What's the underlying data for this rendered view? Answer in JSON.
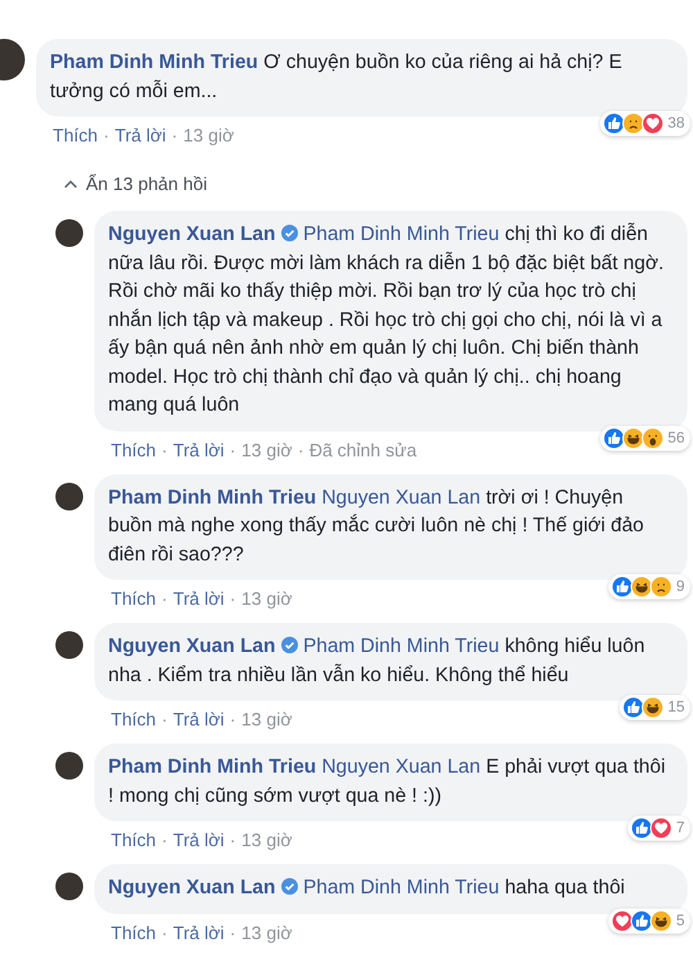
{
  "separator": "·",
  "comment": {
    "author": "Pham Dinh Minh Trieu",
    "text": "Ơ chuyện buồn ko của riêng ai hả chị? E tưởng có mỗi em...",
    "actions": [
      "Thích",
      "Trả lời",
      "13 giờ"
    ],
    "reactions": [
      {
        "kind": "like"
      },
      {
        "kind": "sad"
      },
      {
        "kind": "love"
      }
    ],
    "count": "38"
  },
  "toggle": {
    "label": "Ẩn 13 phản hồi",
    "expanded": true
  },
  "replies": [
    {
      "author": "Nguyen Xuan Lan",
      "verified": true,
      "mention": "Pham Dinh Minh Trieu",
      "text": "chị thì ko đi diễn nữa lâu rồi. Được mời làm khách ra diễn 1 bộ đặc biệt bất ngờ. Rồi chờ mãi ko thấy thiệp mời. Rồi bạn trơ lý của học trò chị nhắn lịch tập và makeup . Rồi học trò chị gọi cho chị, nói là vì a ấy bận quá nên ảnh nhờ em quản lý chị luôn. Chị biến thành model. Học trò chị thành chỉ đạo và quản lý chị.. chị hoang mang quá luôn",
      "actions": [
        "Thích",
        "Trả lời",
        "13 giờ",
        "Đã chỉnh sửa"
      ],
      "reactions": [
        {
          "kind": "like"
        },
        {
          "kind": "haha"
        },
        {
          "kind": "wow"
        }
      ],
      "count": "56"
    },
    {
      "author": "Pham Dinh Minh Trieu",
      "verified": false,
      "mention": "Nguyen Xuan Lan",
      "text": "trời ơi ! Chuyện buồn mà nghe xong thấy mắc cười luôn nè chị ! Thế giới đảo điên rồi sao???",
      "actions": [
        "Thích",
        "Trả lời",
        "13 giờ"
      ],
      "reactions": [
        {
          "kind": "like"
        },
        {
          "kind": "haha"
        },
        {
          "kind": "sad"
        }
      ],
      "count": "9"
    },
    {
      "author": "Nguyen Xuan Lan",
      "verified": true,
      "mention": "Pham Dinh Minh Trieu",
      "text": "không hiểu luôn nha . Kiểm tra nhiều lần vẫn ko hiểu. Không thể hiểu",
      "actions": [
        "Thích",
        "Trả lời",
        "13 giờ"
      ],
      "reactions": [
        {
          "kind": "like"
        },
        {
          "kind": "haha"
        }
      ],
      "count": "15"
    },
    {
      "author": "Pham Dinh Minh Trieu",
      "verified": false,
      "mention": "Nguyen Xuan Lan",
      "text": "E phải vượt qua thôi ! mong chị cũng sớm vượt qua nè ! :))",
      "actions": [
        "Thích",
        "Trả lời",
        "13 giờ"
      ],
      "reactions": [
        {
          "kind": "like"
        },
        {
          "kind": "love"
        }
      ],
      "count": "7"
    },
    {
      "author": "Nguyen Xuan Lan",
      "verified": true,
      "mention": "Pham Dinh Minh Trieu",
      "text": "haha qua thôi",
      "actions": [
        "Thích",
        "Trả lời",
        "13 giờ"
      ],
      "reactions": [
        {
          "kind": "love"
        },
        {
          "kind": "like"
        },
        {
          "kind": "haha"
        }
      ],
      "count": "5"
    }
  ]
}
